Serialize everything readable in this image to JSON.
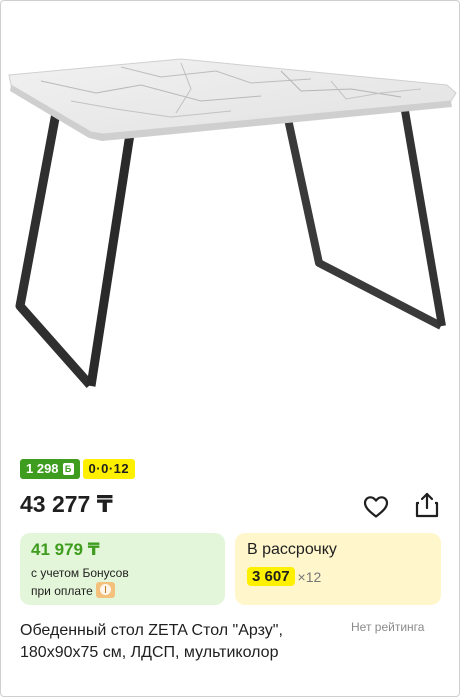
{
  "product": {
    "bonus_badge": "1 298",
    "installment_badge": "0·0·12",
    "price": "43 277 ₸",
    "title": "Обеденный стол ZETA Стол \"Арзу\", 180x90x75 см, ЛДСП, мультиколор",
    "rating": "Нет рейтинга"
  },
  "bonus_card": {
    "price": "41 979 ₸",
    "caption_line1": "с учетом Бонусов",
    "caption_line2": "при оплате"
  },
  "installment_card": {
    "title": "В рассрочку",
    "amount": "3 607",
    "months": "×12"
  },
  "icons": {
    "bonus": "bonus-b-icon",
    "favorite": "heart-icon",
    "share": "share-icon",
    "payment": "coin-icon"
  },
  "colors": {
    "bonus_green": "#3e9c1e",
    "installment_yellow": "#fff000",
    "bonus_card_bg": "#e4f6d9",
    "installment_card_bg": "#fff6cc"
  }
}
